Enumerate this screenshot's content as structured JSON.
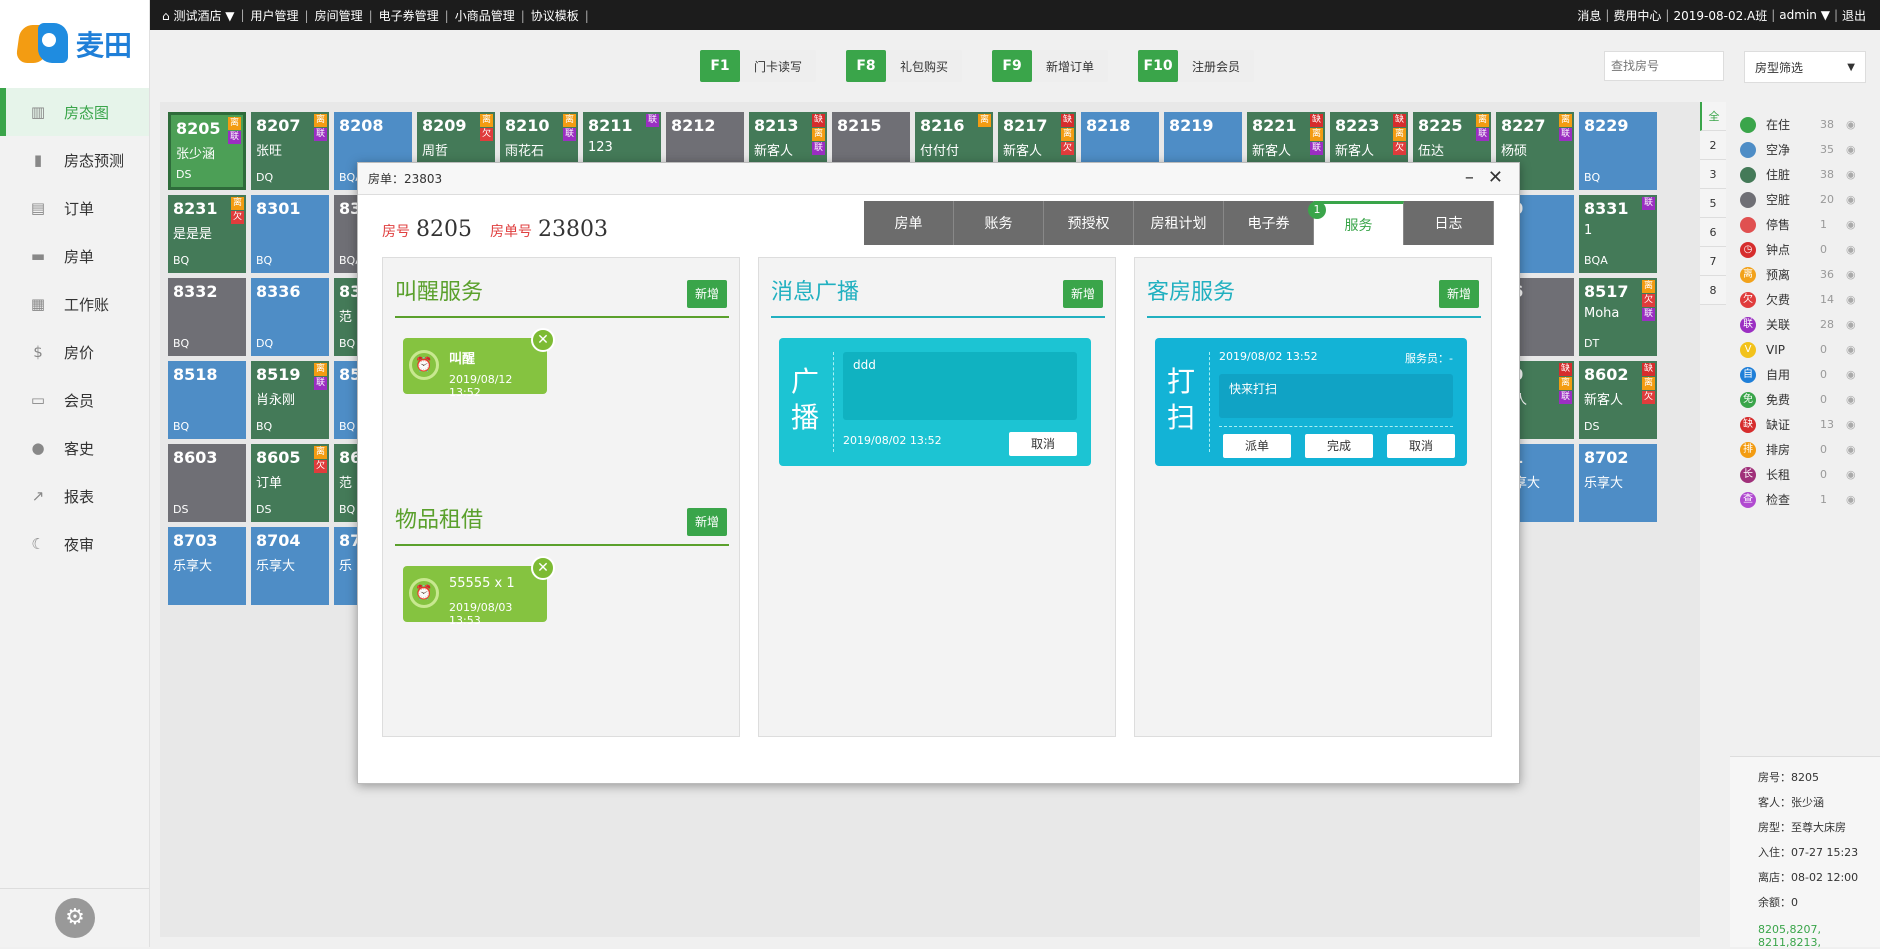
{
  "app": {
    "name": "麦田"
  },
  "sidebar": {
    "items": [
      {
        "label": "房态图",
        "icon": "building-icon"
      },
      {
        "label": "房态预测",
        "icon": "chart-icon"
      },
      {
        "label": "订单",
        "icon": "order-icon"
      },
      {
        "label": "房单",
        "icon": "document-icon"
      },
      {
        "label": "工作账",
        "icon": "ledger-icon"
      },
      {
        "label": "房价",
        "icon": "price-icon"
      },
      {
        "label": "会员",
        "icon": "card-icon"
      },
      {
        "label": "客史",
        "icon": "user-icon"
      },
      {
        "label": "报表",
        "icon": "report-icon"
      },
      {
        "label": "夜审",
        "icon": "moon-icon"
      }
    ]
  },
  "topbar": {
    "hotel": "测试酒店 ▼",
    "items": [
      "用户管理",
      "房间管理",
      "电子券管理",
      "小商品管理",
      "协议模板"
    ],
    "right": [
      "消息",
      "费用中心",
      "2019-08-02.A班",
      "admin ▼",
      "退出"
    ]
  },
  "fkeys": [
    {
      "key": "F1",
      "label": "门卡读写"
    },
    {
      "key": "F8",
      "label": "礼包购买"
    },
    {
      "key": "F9",
      "label": "新增订单"
    },
    {
      "key": "F10",
      "label": "注册会员"
    }
  ],
  "search": {
    "placeholder": "查找房号"
  },
  "type_filter": {
    "value": "房型筛选"
  },
  "rooms": [
    {
      "num": "8205",
      "guest": "张少涵",
      "type": "DS",
      "tags": [
        "离",
        "联"
      ],
      "color": "green"
    },
    {
      "num": "8207",
      "guest": "张旺",
      "type": "DQ",
      "tags": [
        "离",
        "联"
      ],
      "color": "dirty"
    },
    {
      "num": "8208",
      "guest": "",
      "type": "BQA",
      "tags": [],
      "color": "empty"
    },
    {
      "num": "8209",
      "guest": "周哲",
      "type": "",
      "tags": [
        "离",
        "欠"
      ],
      "color": "dirty"
    },
    {
      "num": "8210",
      "guest": "雨花石",
      "type": "",
      "tags": [
        "离",
        "联"
      ],
      "color": "dirty"
    },
    {
      "num": "8211",
      "guest": "123",
      "type": "",
      "tags": [
        "联"
      ],
      "color": "dirty"
    },
    {
      "num": "8212",
      "guest": "",
      "type": "",
      "tags": [],
      "color": "grey"
    },
    {
      "num": "8213",
      "guest": "新客人",
      "type": "",
      "tags": [
        "缺",
        "离",
        "联"
      ],
      "color": "dirty"
    },
    {
      "num": "8215",
      "guest": "",
      "type": "",
      "tags": [],
      "color": "grey"
    },
    {
      "num": "8216",
      "guest": "付付付",
      "type": "",
      "tags": [
        "离"
      ],
      "color": "dirty"
    },
    {
      "num": "8217",
      "guest": "新客人",
      "type": "",
      "tags": [
        "缺",
        "离",
        "欠"
      ],
      "color": "dirty"
    },
    {
      "num": "8218",
      "guest": "",
      "type": "",
      "tags": [],
      "color": "empty"
    },
    {
      "num": "8219",
      "guest": "",
      "type": "",
      "tags": [],
      "color": "empty"
    },
    {
      "num": "8221",
      "guest": "新客人",
      "type": "",
      "tags": [
        "缺",
        "离",
        "联"
      ],
      "color": "dirty"
    },
    {
      "num": "8223",
      "guest": "新客人",
      "type": "",
      "tags": [
        "缺",
        "离",
        "欠"
      ],
      "color": "dirty"
    },
    {
      "num": "8225",
      "guest": "伍达",
      "type": "",
      "tags": [
        "离",
        "联"
      ],
      "color": "dirty"
    },
    {
      "num": "8227",
      "guest": "杨硕",
      "type": "",
      "tags": [
        "离",
        "联"
      ],
      "color": "dirty"
    },
    {
      "num": "8229",
      "guest": "",
      "type": "BQ",
      "tags": [],
      "color": "empty"
    },
    {
      "num": "8231",
      "guest": "是是是",
      "type": "BQ",
      "tags": [
        "离",
        "欠"
      ],
      "color": "dirty"
    },
    {
      "num": "8301",
      "guest": "",
      "type": "BQ",
      "tags": [],
      "color": "empty"
    },
    {
      "num": "83",
      "guest": "",
      "type": "BQA",
      "tags": [],
      "color": "grey"
    },
    {
      "num": "30",
      "guest": "",
      "type": "",
      "tags": [],
      "color": "empty"
    },
    {
      "num": "8331",
      "guest": "1",
      "type": "BQA",
      "tags": [
        "联"
      ],
      "color": "dirty"
    },
    {
      "num": "8332",
      "guest": "",
      "type": "BQ",
      "tags": [],
      "color": "grey"
    },
    {
      "num": "8336",
      "guest": "",
      "type": "DQ",
      "tags": [],
      "color": "empty"
    },
    {
      "num": "83",
      "guest": "范",
      "type": "BQ",
      "tags": [],
      "color": "dirty"
    },
    {
      "num": "16",
      "guest": "",
      "type": "",
      "tags": [],
      "color": "grey"
    },
    {
      "num": "8517",
      "guest": "Moha",
      "type": "DT",
      "tags": [
        "离",
        "欠",
        "联"
      ],
      "color": "dirty"
    },
    {
      "num": "8518",
      "guest": "",
      "type": "BQ",
      "tags": [],
      "color": "empty"
    },
    {
      "num": "8519",
      "guest": "肖永刚",
      "type": "BQ",
      "tags": [
        "离",
        "联"
      ],
      "color": "dirty"
    },
    {
      "num": "85",
      "guest": "",
      "type": "BQ",
      "tags": [],
      "color": "empty"
    },
    {
      "num": "40",
      "guest": "客人",
      "type": "A",
      "tags": [
        "缺",
        "离",
        "联"
      ],
      "color": "dirty"
    },
    {
      "num": "8602",
      "guest": "新客人",
      "type": "DS",
      "tags": [
        "缺",
        "离",
        "欠"
      ],
      "color": "dirty"
    },
    {
      "num": "8603",
      "guest": "",
      "type": "DS",
      "tags": [],
      "color": "grey"
    },
    {
      "num": "8605",
      "guest": "订单",
      "type": "DS",
      "tags": [
        "离",
        "欠"
      ],
      "color": "dirty"
    },
    {
      "num": "86",
      "guest": "范",
      "type": "BQ",
      "tags": [],
      "color": "dirty"
    },
    {
      "num": "01",
      "guest": "乐享大",
      "type": "",
      "tags": [],
      "color": "empty"
    },
    {
      "num": "8702",
      "guest": "乐享大",
      "type": "",
      "tags": [],
      "color": "empty"
    },
    {
      "num": "8703",
      "guest": "乐享大",
      "type": "",
      "tags": [],
      "color": "empty"
    },
    {
      "num": "8704",
      "guest": "乐享大",
      "type": "",
      "tags": [],
      "color": "empty"
    },
    {
      "num": "87",
      "guest": "乐",
      "type": "",
      "tags": [],
      "color": "empty"
    }
  ],
  "floor_tabs": [
    "全",
    "2",
    "3",
    "5",
    "6",
    "7",
    "8"
  ],
  "legend": [
    {
      "label": "在住",
      "count": "38",
      "color": "#3aa54a",
      "glyph": ""
    },
    {
      "label": "空净",
      "count": "35",
      "color": "#4e8dc6",
      "glyph": ""
    },
    {
      "label": "住脏",
      "count": "38",
      "color": "#447a58",
      "glyph": ""
    },
    {
      "label": "空脏",
      "count": "20",
      "color": "#6f6f75",
      "glyph": ""
    },
    {
      "label": "停售",
      "count": "1",
      "color": "#e05050",
      "glyph": ""
    },
    {
      "label": "钟点",
      "count": "0",
      "color": "#d62d2d",
      "glyph": "◷"
    },
    {
      "label": "预离",
      "count": "36",
      "color": "#f2a21b",
      "glyph": "离"
    },
    {
      "label": "欠费",
      "count": "14",
      "color": "#e03c3c",
      "glyph": "欠"
    },
    {
      "label": "关联",
      "count": "28",
      "color": "#9b2fc2",
      "glyph": "联"
    },
    {
      "label": "VIP",
      "count": "0",
      "color": "#f2c21b",
      "glyph": "V"
    },
    {
      "label": "自用",
      "count": "0",
      "color": "#1f7fd8",
      "glyph": "自"
    },
    {
      "label": "免费",
      "count": "0",
      "color": "#3aa54a",
      "glyph": "免"
    },
    {
      "label": "缺证",
      "count": "13",
      "color": "#d62d2d",
      "glyph": "缺"
    },
    {
      "label": "排房",
      "count": "0",
      "color": "#f39c12",
      "glyph": "排"
    },
    {
      "label": "长租",
      "count": "0",
      "color": "#a0307a",
      "glyph": "长"
    },
    {
      "label": "检查",
      "count": "1",
      "color": "#b04ad0",
      "glyph": "查"
    }
  ],
  "info": {
    "room": "房号：8205",
    "guest": "客人：张少涵",
    "type": "房型：至尊大床房",
    "checkin": "入住：07-27 15:23",
    "checkout": "离店：08-02 12:00",
    "balance": "余额：0",
    "rooms": "8205,8207,",
    "rooms2": "8211,8213,"
  },
  "dialog": {
    "title": "房单：23803",
    "room_label": "房号",
    "room_value": "8205",
    "order_label": "房单号",
    "order_value": "23803",
    "tabs": [
      "房单",
      "账务",
      "预授权",
      "房租计划",
      "电子券",
      "服务",
      "日志"
    ],
    "tab_badge": "1",
    "wake": {
      "title": "叫醒服务",
      "add": "新增",
      "card": {
        "name": "叫醒",
        "time": "2019/08/12 13:52"
      }
    },
    "rental": {
      "title": "物品租借",
      "add": "新增",
      "card": {
        "name": "55555 x 1",
        "time": "2019/08/03 13:53"
      }
    },
    "broadcast": {
      "title": "消息广播",
      "add": "新增",
      "vertical": "广播",
      "content": "ddd",
      "time": "2019/08/02 13:52",
      "cancel": "取消"
    },
    "housekeeping": {
      "title": "客房服务",
      "add": "新增",
      "vertical": "打扫",
      "time": "2019/08/02 13:52",
      "staff": "服务员：-",
      "content": "快来打扫",
      "dispatch": "派单",
      "done": "完成",
      "cancel": "取消"
    }
  }
}
